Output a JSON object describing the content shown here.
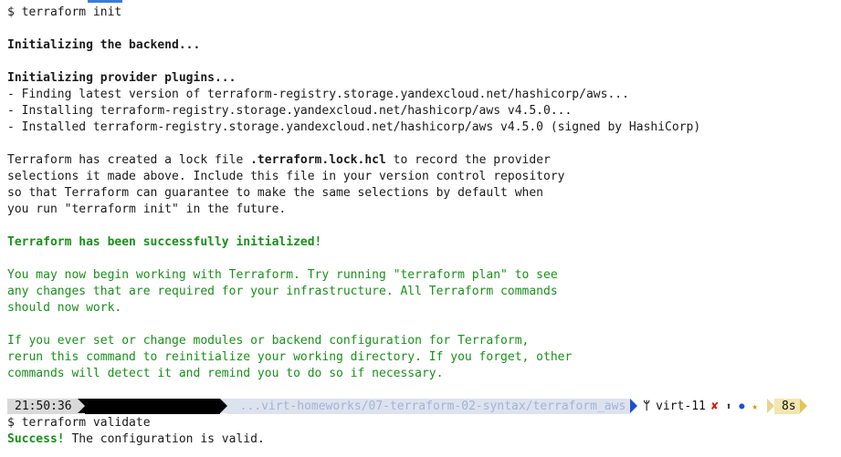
{
  "terminal": {
    "cmd_init": "$ terraform init",
    "backend": "Initializing the backend...",
    "providers": "Initializing provider plugins...",
    "finding": "- Finding latest version of terraform-registry.storage.yandexcloud.net/hashicorp/aws...",
    "installing": "- Installing terraform-registry.storage.yandexcloud.net/hashicorp/aws v4.5.0...",
    "installed": "- Installed terraform-registry.storage.yandexcloud.net/hashicorp/aws v4.5.0 (signed by HashiCorp)",
    "lock_pre": "Terraform has created a lock file ",
    "lock_file": ".terraform.lock.hcl",
    "lock_post": " to record the provider",
    "lock2": "selections it made above. Include this file in your version control repository",
    "lock3": "so that Terraform can guarantee to make the same selections by default when",
    "lock4": "you run \"terraform init\" in the future.",
    "success_init": "Terraform has been successfully initialized!",
    "begin1": "You may now begin working with Terraform. Try running \"terraform plan\" to see",
    "begin2": "any changes that are required for your infrastructure. All Terraform commands",
    "begin3": "should now work.",
    "ever1": "If you ever set or change modules or backend configuration for Terraform,",
    "ever2": "rerun this command to reinitialize your working directory. If you forget, other",
    "ever3": "commands will detect it and remind you to do so if necessary.",
    "cmd_validate": "$ terraform validate",
    "success_word": "Success!",
    "valid_msg": " The configuration is valid."
  },
  "status_bar": {
    "time": "21:50:36",
    "path": "...virt-homeworks/07-terraform-02-syntax/terraform_aws",
    "branch": "virt-11",
    "mark_x": "✘",
    "mark_up": "⬆",
    "mark_dot": "●",
    "mark_star": "★",
    "duration": "8s",
    "branch_icon": "git-branch-icon"
  },
  "colors": {
    "success_green": "#1a8f1a",
    "path_text": "#a3b3d4",
    "path_bg": "#dde3ee",
    "path_arrow": "#1e4fd0",
    "time_bg": "#d9d9d9",
    "duration_bg": "#f3e6b0",
    "error_red": "#dd1111",
    "accent_blue": "#3b7dd8"
  }
}
